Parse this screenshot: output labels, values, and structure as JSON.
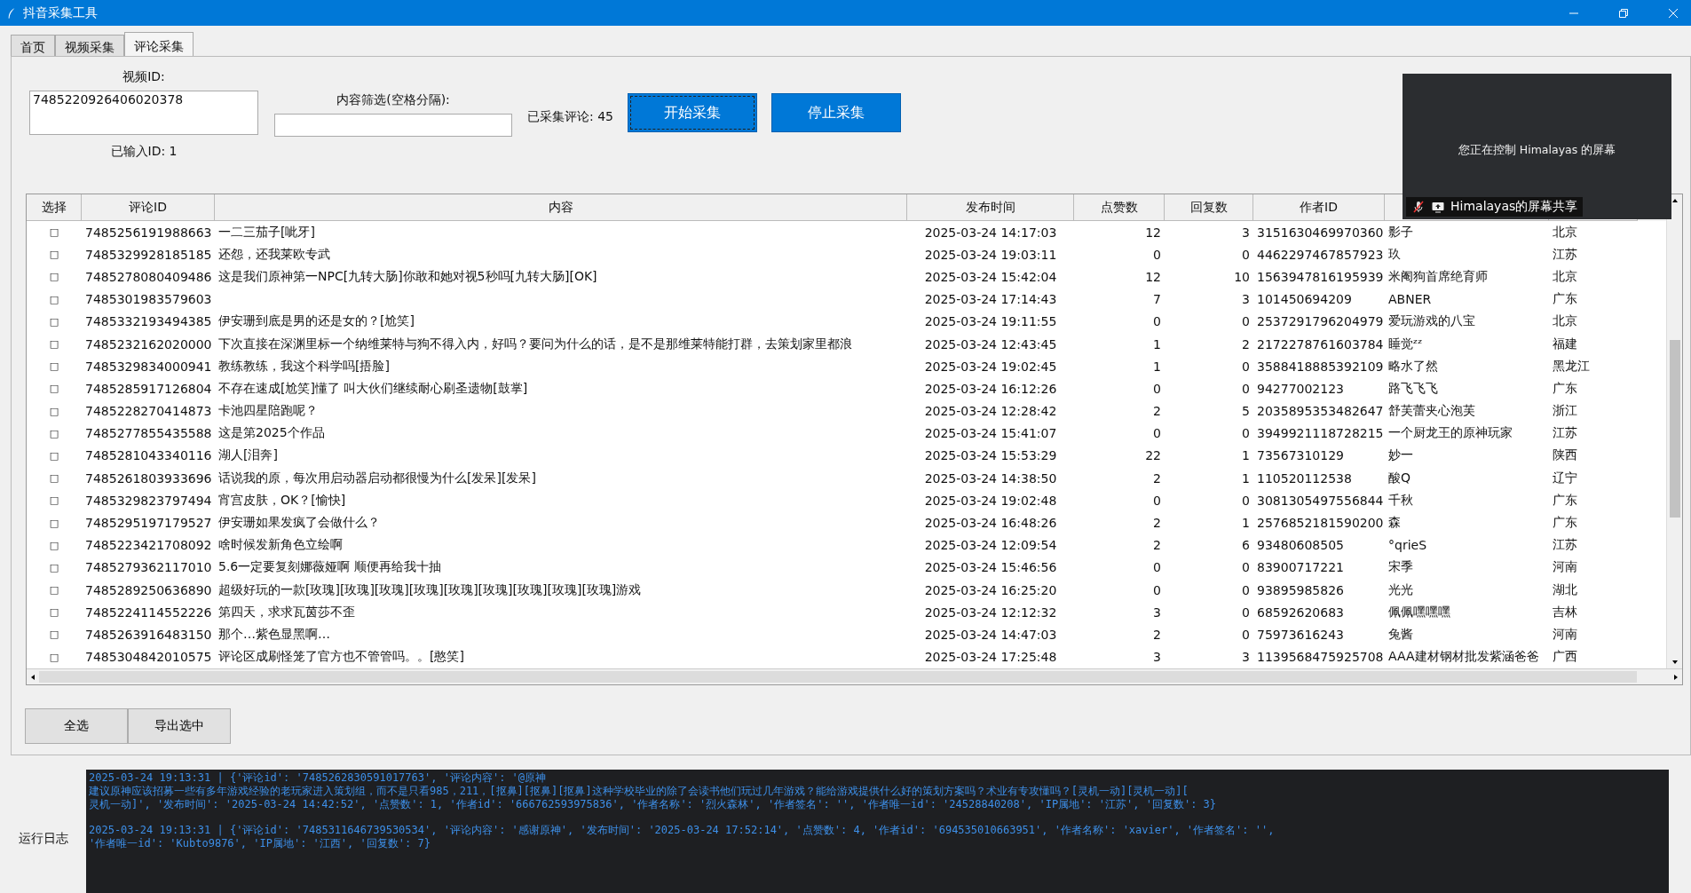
{
  "window": {
    "title": "抖音采集工具"
  },
  "tabs": [
    {
      "label": "首页",
      "selected": false
    },
    {
      "label": "视频采集",
      "selected": false
    },
    {
      "label": "评论采集",
      "selected": true
    }
  ],
  "form": {
    "video_id_label": "视频ID:",
    "video_id_value": "7485220926406020378",
    "entered_count": "已输入ID: 1",
    "filter_label": "内容筛选(空格分隔):",
    "collected": "已采集评论: 45",
    "buttons": [
      {
        "label": "开始采集",
        "focused": true
      },
      {
        "label": "停止采集",
        "focused": false
      }
    ]
  },
  "table": {
    "columns": [
      "选择",
      "评论ID",
      "内容",
      "发布时间",
      "点赞数",
      "回复数",
      "作者ID"
    ],
    "rows": [
      {
        "select": "□",
        "id": "7485256191988663",
        "content": "一二三茄子[呲牙]",
        "time": "2025-03-24 14:17:03",
        "likes": "12",
        "replies": "3",
        "author_id": "3151630469970360",
        "column_8": "影子",
        "column_9": "北京"
      },
      {
        "select": "□",
        "id": "7485329928185185",
        "content": "还怨，还我莱欧专武",
        "time": "2025-03-24 19:03:11",
        "likes": "0",
        "replies": "0",
        "author_id": "4462297467857923",
        "column_8": "玖",
        "column_9": "江苏"
      },
      {
        "select": "□",
        "id": "7485278080409486",
        "content": "这是我们原神第一NPC[九转大肠]你敢和她对视5秒吗[九转大肠][OK]",
        "time": "2025-03-24 15:42:04",
        "likes": "12",
        "replies": "10",
        "author_id": "1563947816195939",
        "column_8": "米阉狗首席绝育师",
        "column_9": "北京"
      },
      {
        "select": "□",
        "id": "7485301983579603",
        "time": "2025-03-24 17:14:43",
        "likes": "7",
        "replies": "3",
        "author_id": "101450694209",
        "column_8": "ABNER",
        "column_9": "广东"
      },
      {
        "select": "□",
        "id": "7485332193494385",
        "content": "伊安珊到底是男的还是女的？[尬笑]",
        "time": "2025-03-24 19:11:55",
        "likes": "0",
        "replies": "0",
        "author_id": "2537291796204979",
        "column_8": "爱玩游戏的八宝",
        "column_9": "北京"
      },
      {
        "select": "□",
        "id": "7485232162020000",
        "content": "下次直接在深渊里标一个纳维莱特与狗不得入内，好吗？要问为什么的话，是不是那维莱特能打群，去策划家里都浪",
        "time": "2025-03-24 12:43:45",
        "likes": "1",
        "replies": "2",
        "author_id": "2172278761603784",
        "column_8": "睡觉ᶻᶻ",
        "column_9": "福建"
      },
      {
        "select": "□",
        "id": "7485329834000941",
        "content": "教练教练，我这个科学吗[捂脸]",
        "time": "2025-03-24 19:02:45",
        "likes": "1",
        "replies": "0",
        "author_id": "3588418885392109",
        "column_8": "略水了然",
        "column_9": "黑龙江"
      },
      {
        "select": "□",
        "id": "7485285917126804",
        "content": "不存在速成[尬笑]懂了 叫大伙们继续耐心刷圣遗物[鼓掌]",
        "time": "2025-03-24 16:12:26",
        "likes": "0",
        "replies": "0",
        "author_id": "94277002123",
        "column_8": "路飞飞飞",
        "column_9": "广东"
      },
      {
        "select": "□",
        "id": "7485228270414873",
        "content": "卡池四星陪跑呢？",
        "time": "2025-03-24 12:28:42",
        "likes": "2",
        "replies": "5",
        "author_id": "2035895353482647",
        "column_8": "舒芙蕾夹心泡芙",
        "column_9": "浙江"
      },
      {
        "select": "□",
        "id": "7485277855435588",
        "content": "这是第2025个作品",
        "time": "2025-03-24 15:41:07",
        "likes": "0",
        "replies": "0",
        "author_id": "3949921118728215",
        "column_8": "一个厨龙王的原神玩家",
        "column_9": "江苏"
      },
      {
        "select": "□",
        "id": "7485281043340116",
        "content": "湖人[泪奔]",
        "time": "2025-03-24 15:53:29",
        "likes": "22",
        "replies": "1",
        "author_id": "73567310129",
        "column_8": "妙一",
        "column_9": "陕西"
      },
      {
        "select": "□",
        "id": "7485261803933696",
        "content": "话说我的原，每次用启动器启动都很慢为什么[发呆][发呆]",
        "time": "2025-03-24 14:38:50",
        "likes": "2",
        "replies": "1",
        "author_id": "110520112538",
        "column_8": "酸Q",
        "column_9": "辽宁"
      },
      {
        "select": "□",
        "id": "7485329823797494",
        "content": "宵宫皮肤，OK？[愉快]",
        "time": "2025-03-24 19:02:48",
        "likes": "0",
        "replies": "0",
        "author_id": "3081305497556844",
        "column_8": "千秋",
        "column_9": "广东"
      },
      {
        "select": "□",
        "id": "7485295197179527",
        "content": "伊安珊如果发疯了会做什么？",
        "time": "2025-03-24 16:48:26",
        "likes": "2",
        "replies": "1",
        "author_id": "2576852181590200",
        "column_8": "森",
        "column_9": "广东"
      },
      {
        "select": "□",
        "id": "7485223421708092",
        "content": "啥时候发新角色立绘啊",
        "time": "2025-03-24 12:09:54",
        "likes": "2",
        "replies": "6",
        "author_id": "93480608505",
        "column_8": "°qrieS",
        "column_9": "江苏"
      },
      {
        "select": "□",
        "id": "7485279362117010",
        "content": "5.6一定要复刻娜薇娅啊 顺便再给我十抽",
        "time": "2025-03-24 15:46:56",
        "likes": "0",
        "replies": "0",
        "author_id": "83900717221",
        "column_8": "宋季",
        "column_9": "河南"
      },
      {
        "select": "□",
        "id": "7485289250636890",
        "content": "超级好玩的一款[玫瑰][玫瑰][玫瑰][玫瑰][玫瑰][玫瑰][玫瑰][玫瑰][玫瑰]游戏",
        "time": "2025-03-24 16:25:20",
        "likes": "0",
        "replies": "0",
        "author_id": "93895985826",
        "column_8": "光光",
        "column_9": "湖北"
      },
      {
        "select": "□",
        "id": "7485224114552226",
        "content": "第四天，求求瓦茵莎不歪",
        "time": "2025-03-24 12:12:32",
        "likes": "3",
        "replies": "0",
        "author_id": "68592620683",
        "column_8": "佩佩嘿嘿嘿",
        "column_9": "吉林"
      },
      {
        "select": "□",
        "id": "7485263916483150",
        "content": "那个…紫色显黑啊…",
        "time": "2025-03-24 14:47:03",
        "likes": "2",
        "replies": "0",
        "author_id": "75973616243",
        "column_8": "兔酱",
        "column_9": "河南"
      },
      {
        "select": "□",
        "id": "7485304842010575",
        "content": "评论区成刷怪笼了官方也不管管吗。。[憨笑]",
        "time": "2025-03-24 17:25:48",
        "likes": "3",
        "replies": "3",
        "author_id": "1139568475925708",
        "column_8": "AAA建材钢材批发紫涵爸爸",
        "column_9": "广西"
      }
    ]
  },
  "actions": [
    "全选",
    "导出选中"
  ],
  "log": {
    "label": "运行日志",
    "entries": [
      [
        "2025-03-24 19:13:31 | {'评论id': '7485262830591017763', '评论内容': '@原神",
        "建议原神应该招募一些有多年游戏经验的老玩家进入策划组，而不是只看985，211，[抠鼻][抠鼻][抠鼻]这种学校毕业的除了会读书他们玩过几年游戏？能给游戏提供什么好的策划方案吗？术业有专攻懂吗？[灵机一动][灵机一动][",
        "灵机一动]', '发布时间': '2025-03-24 14:42:52', '点赞数': 1, '作者id': '666762593975836', '作者名称': '烈火森林', '作者签名': '', '作者唯一id': '24528840208', 'IP属地': '江苏', '回复数': 3}"
      ],
      [
        "2025-03-24 19:13:31 | {'评论id': '7485311646739530534', '评论内容': '感谢原神', '发布时间': '2025-03-24 17:52:14', '点赞数': 4, '作者id': '694535010663951', '作者名称': 'xavier', '作者签名': '',",
        "'作者唯一id': 'Kubto9876', 'IP属地': '江西', '回复数': 7}"
      ]
    ]
  },
  "overlay": {
    "message": "您正在控制 Himalayas 的屏幕",
    "share_label": "Himalayas的屏幕共享"
  }
}
